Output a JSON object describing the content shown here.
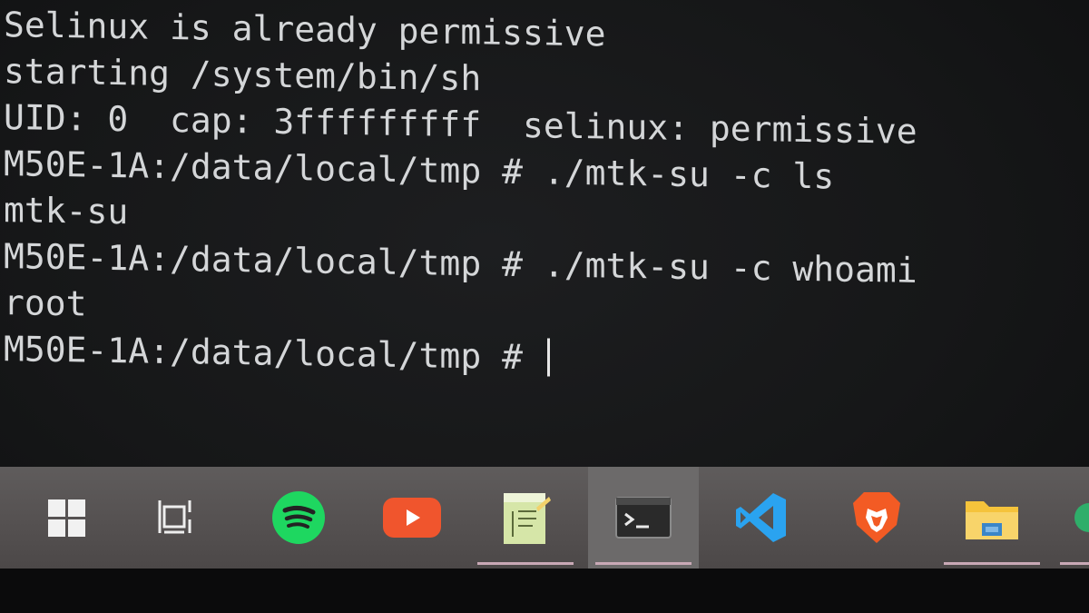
{
  "terminal": {
    "lines": [
      "Selinux is already permissive",
      "starting /system/bin/sh",
      "UID: 0  cap: 3fffffffff  selinux: permissive",
      "M50E-1A:/data/local/tmp # ./mtk-su -c ls",
      "mtk-su",
      "M50E-1A:/data/local/tmp # ./mtk-su -c whoami",
      "root",
      "M50E-1A:/data/local/tmp # "
    ]
  },
  "taskbar": {
    "items": [
      {
        "icon": "windows-start-icon"
      },
      {
        "icon": "task-view-icon"
      },
      {
        "icon": "spotify-icon",
        "color": "#1ed760"
      },
      {
        "icon": "youtube-icon",
        "color": "#f0552d"
      },
      {
        "icon": "notepad-icon",
        "color": "#d6e6a8"
      },
      {
        "icon": "terminal-icon"
      },
      {
        "icon": "vscode-icon",
        "color": "#2aa3f0"
      },
      {
        "icon": "brave-icon",
        "color": "#f35b24"
      },
      {
        "icon": "file-explorer-icon",
        "color": "#f5c33b"
      },
      {
        "icon": "app-icon"
      }
    ]
  }
}
